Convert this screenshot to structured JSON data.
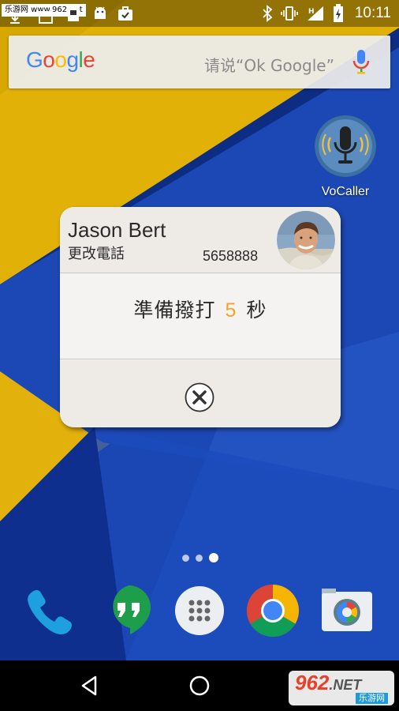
{
  "status_bar": {
    "watermark": "乐游网 www.962.net",
    "time": "10:11"
  },
  "search": {
    "logo": [
      "G",
      "o",
      "o",
      "g",
      "l",
      "e"
    ],
    "hint": "请说“Ok Google”"
  },
  "home_app": {
    "label": "VoCaller"
  },
  "call_dialog": {
    "contact_name": "Jason Bert",
    "change_phone": "更改電話",
    "phone_number": "5658888",
    "countdown_prefix": "準備撥打",
    "countdown_seconds": "5",
    "countdown_suffix": "秒"
  },
  "page_indicator": {
    "count": 3,
    "active_index": 2
  },
  "dock": {
    "apps": [
      "phone-icon",
      "hangouts-icon",
      "app-drawer-icon",
      "chrome-icon",
      "camera-icon"
    ]
  },
  "watermark_logo": {
    "text": "962",
    "suffix": ".NET",
    "sub": "乐游网"
  },
  "colors": {
    "accent_orange": "#f5a326",
    "wallpaper_blue": "#1a3a8f",
    "wallpaper_yellow": "#e6b500"
  }
}
